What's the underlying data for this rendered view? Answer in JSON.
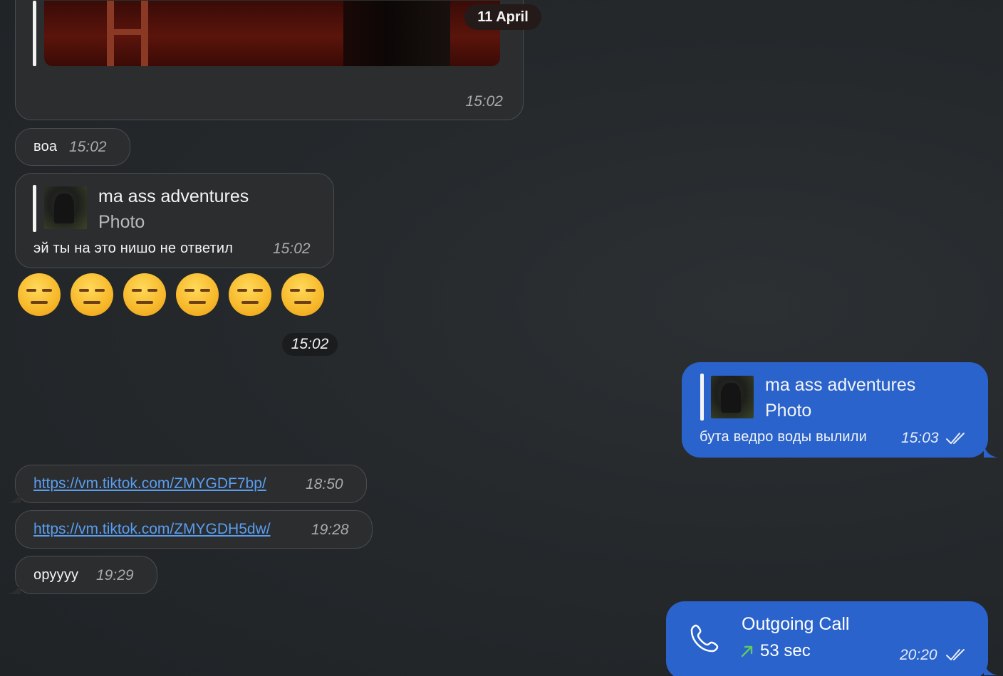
{
  "date_separator": "11 April",
  "messages": {
    "photo": {
      "time": "15:02"
    },
    "voa": {
      "text": "воа",
      "time": "15:02"
    },
    "reply_in": {
      "reply_title": "ma ass adventures",
      "reply_sub": "Photo",
      "text": "эй ты на это нишо не ответил",
      "time": "15:02"
    },
    "emoji": {
      "glyph": "😑",
      "count": 6,
      "time": "15:02"
    },
    "reply_out": {
      "reply_title": "ma ass adventures",
      "reply_sub": "Photo",
      "text": "бута ведро воды вылили",
      "time": "15:03"
    },
    "link1": {
      "url": "https://vm.tiktok.com/ZMYGDF7bp/",
      "time": "18:50"
    },
    "link2": {
      "url": "https://vm.tiktok.com/ZMYGDH5dw/",
      "time": "19:28"
    },
    "oruuu": {
      "text": "орууyy",
      "time": "19:29"
    },
    "call": {
      "title": "Outgoing Call",
      "duration": "53 sec",
      "time": "20:20",
      "icon": "phone-icon",
      "direction_icon": "outgoing-arrow-icon"
    }
  },
  "colors": {
    "outgoing_bubble": "#2a63cc",
    "incoming_bubble": "#2b2d2f",
    "link": "#5a9ef0",
    "call_arrow": "#5fcb5f"
  }
}
